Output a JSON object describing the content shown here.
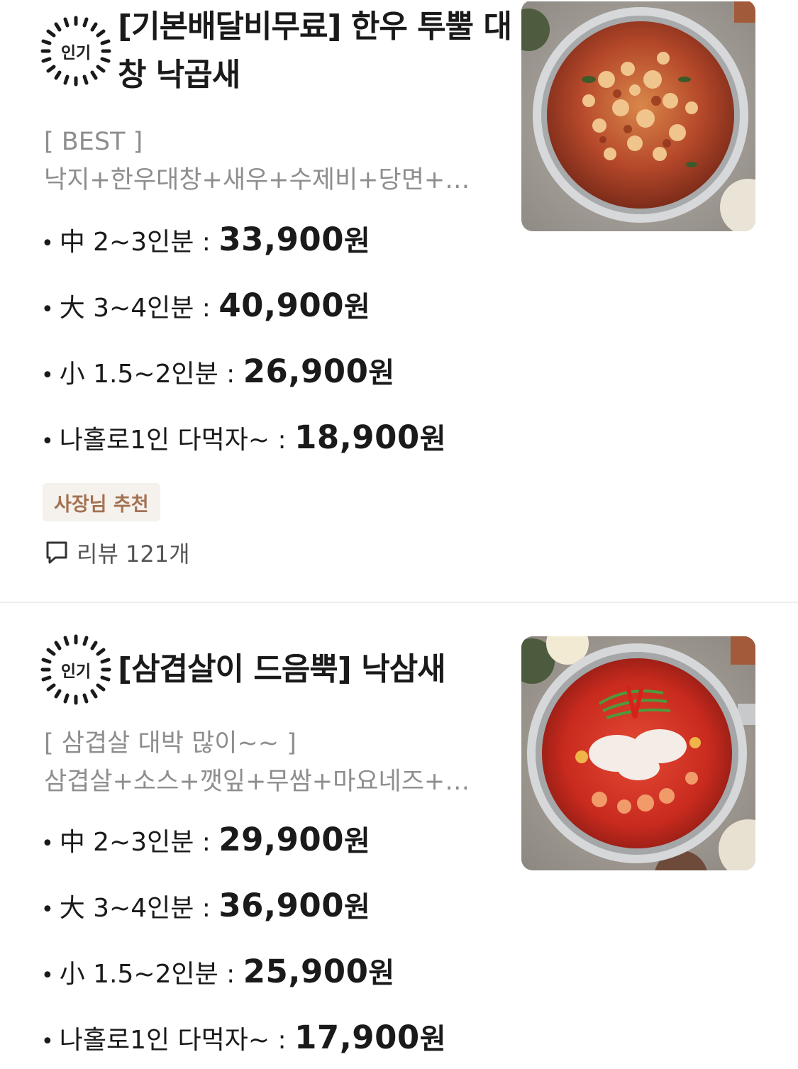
{
  "items": [
    {
      "badge": "인기",
      "title": "[기본배달비무료] 한우 투뿔 대창 낙곱새",
      "desc_head": "[ BEST ]",
      "desc_body": "낙지+한우대창+새우+수제비+당면+…",
      "prices": [
        {
          "label": "中 2~3인분 : ",
          "amount": "33,900",
          "unit": "원"
        },
        {
          "label": "大 3~4인분 : ",
          "amount": "40,900",
          "unit": "원"
        },
        {
          "label": "小 1.5~2인분 : ",
          "amount": "26,900",
          "unit": "원"
        },
        {
          "label": "나홀로1인 다먹자~ : ",
          "amount": "18,900",
          "unit": "원"
        }
      ],
      "tag": "사장님 추천",
      "review": "리뷰 121개",
      "photo_icon": "food-photo"
    },
    {
      "badge": "인기",
      "title": "[삼겹살이 드음뿍] 낙삼새",
      "desc_head": "[ 삼겹살 대박 많이~~ ]",
      "desc_body": "삼겹살+소스+깻잎+무쌈+마요네즈+…",
      "prices": [
        {
          "label": "中 2~3인분 : ",
          "amount": "29,900",
          "unit": "원"
        },
        {
          "label": "大 3~4인분 : ",
          "amount": "36,900",
          "unit": "원"
        },
        {
          "label": "小 1.5~2인분 : ",
          "amount": "25,900",
          "unit": "원"
        },
        {
          "label": "나홀로1인 다먹자~ : ",
          "amount": "17,900",
          "unit": "원"
        }
      ],
      "photo_icon": "food-photo"
    }
  ],
  "colors": {
    "tag_bg": "#f5f1ec",
    "tag_text": "#a37252",
    "description": "#8e8e8e",
    "text": "#1a1a1a"
  }
}
